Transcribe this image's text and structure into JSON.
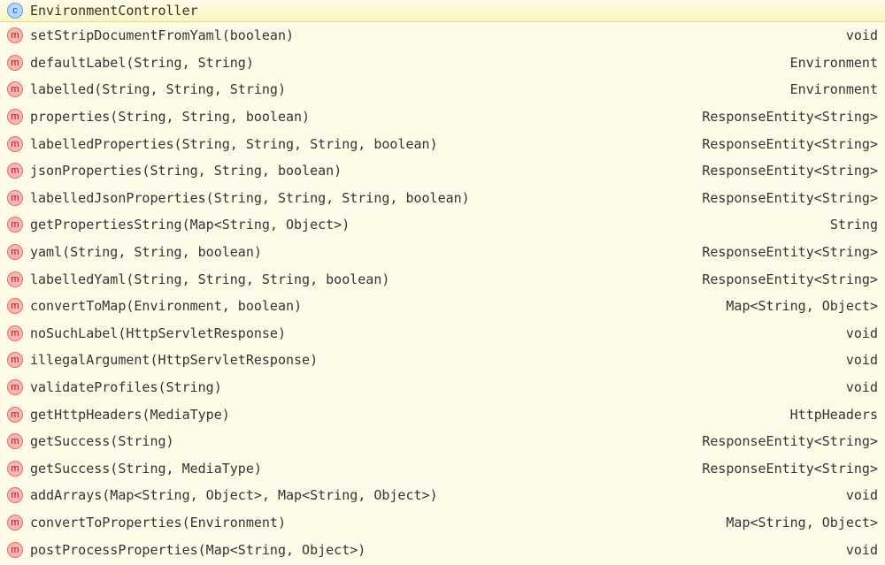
{
  "header": {
    "icon_letter": "c",
    "title": "EnvironmentController"
  },
  "method_icon_letter": "m",
  "methods": [
    {
      "signature": "setStripDocumentFromYaml(boolean)",
      "return_type": "void"
    },
    {
      "signature": "defaultLabel(String, String)",
      "return_type": "Environment"
    },
    {
      "signature": "labelled(String, String, String)",
      "return_type": "Environment"
    },
    {
      "signature": "properties(String, String, boolean)",
      "return_type": "ResponseEntity<String>"
    },
    {
      "signature": "labelledProperties(String, String, String, boolean)",
      "return_type": "ResponseEntity<String>"
    },
    {
      "signature": "jsonProperties(String, String, boolean)",
      "return_type": "ResponseEntity<String>"
    },
    {
      "signature": "labelledJsonProperties(String, String, String, boolean)",
      "return_type": "ResponseEntity<String>"
    },
    {
      "signature": "getPropertiesString(Map<String, Object>)",
      "return_type": "String"
    },
    {
      "signature": "yaml(String, String, boolean)",
      "return_type": "ResponseEntity<String>"
    },
    {
      "signature": "labelledYaml(String, String, String, boolean)",
      "return_type": "ResponseEntity<String>"
    },
    {
      "signature": "convertToMap(Environment, boolean)",
      "return_type": "Map<String, Object>"
    },
    {
      "signature": "noSuchLabel(HttpServletResponse)",
      "return_type": "void"
    },
    {
      "signature": "illegalArgument(HttpServletResponse)",
      "return_type": "void"
    },
    {
      "signature": "validateProfiles(String)",
      "return_type": "void"
    },
    {
      "signature": "getHttpHeaders(MediaType)",
      "return_type": "HttpHeaders"
    },
    {
      "signature": "getSuccess(String)",
      "return_type": "ResponseEntity<String>"
    },
    {
      "signature": "getSuccess(String, MediaType)",
      "return_type": "ResponseEntity<String>"
    },
    {
      "signature": "addArrays(Map<String, Object>, Map<String, Object>)",
      "return_type": "void"
    },
    {
      "signature": "convertToProperties(Environment)",
      "return_type": "Map<String, Object>"
    },
    {
      "signature": "postProcessProperties(Map<String, Object>)",
      "return_type": "void"
    }
  ]
}
